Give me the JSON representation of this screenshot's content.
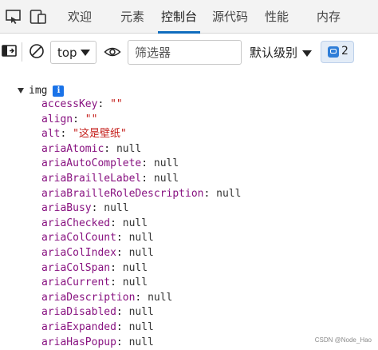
{
  "tabs": [
    {
      "label": "欢迎",
      "active": false
    },
    {
      "label": "元素",
      "active": false
    },
    {
      "label": "控制台",
      "active": true
    },
    {
      "label": "源代码",
      "active": false
    },
    {
      "label": "性能",
      "active": false
    },
    {
      "label": "内存",
      "active": false
    }
  ],
  "toolbar": {
    "context": "top",
    "filter_placeholder": "筛选器",
    "levels_label": "默认级别",
    "issues_count": "2"
  },
  "console": {
    "object_name": "img",
    "info_icon": "i",
    "properties": [
      {
        "key": "accessKey",
        "value": "\"\"",
        "type": "string"
      },
      {
        "key": "align",
        "value": "\"\"",
        "type": "string"
      },
      {
        "key": "alt",
        "value": "\"这是壁纸\"",
        "type": "string"
      },
      {
        "key": "ariaAtomic",
        "value": "null",
        "type": "null"
      },
      {
        "key": "ariaAutoComplete",
        "value": "null",
        "type": "null"
      },
      {
        "key": "ariaBrailleLabel",
        "value": "null",
        "type": "null"
      },
      {
        "key": "ariaBrailleRoleDescription",
        "value": "null",
        "type": "null"
      },
      {
        "key": "ariaBusy",
        "value": "null",
        "type": "null"
      },
      {
        "key": "ariaChecked",
        "value": "null",
        "type": "null"
      },
      {
        "key": "ariaColCount",
        "value": "null",
        "type": "null"
      },
      {
        "key": "ariaColIndex",
        "value": "null",
        "type": "null"
      },
      {
        "key": "ariaColSpan",
        "value": "null",
        "type": "null"
      },
      {
        "key": "ariaCurrent",
        "value": "null",
        "type": "null"
      },
      {
        "key": "ariaDescription",
        "value": "null",
        "type": "null"
      },
      {
        "key": "ariaDisabled",
        "value": "null",
        "type": "null"
      },
      {
        "key": "ariaExpanded",
        "value": "null",
        "type": "null"
      },
      {
        "key": "ariaHasPopup",
        "value": "null",
        "type": "null"
      }
    ]
  },
  "watermark": "CSDN @Node_Hao",
  "colors": {
    "accent": "#0f6cbd",
    "key": "#881280",
    "string": "#c41a16"
  }
}
